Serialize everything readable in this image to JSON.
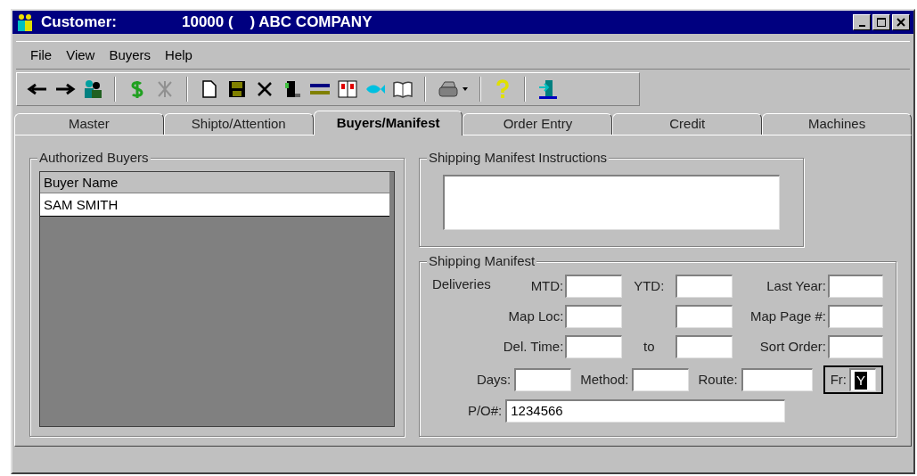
{
  "window": {
    "title_label": "Customer:",
    "title_value": "10000 (    ) ABC COMPANY"
  },
  "menu": [
    "File",
    "View",
    "Buyers",
    "Help"
  ],
  "tabs": [
    {
      "label": "Master",
      "selected": false
    },
    {
      "label": "Shipto/Attention",
      "selected": false
    },
    {
      "label": "Buyers/Manifest",
      "selected": true
    },
    {
      "label": "Order Entry",
      "selected": false
    },
    {
      "label": "Credit",
      "selected": false
    },
    {
      "label": "Machines",
      "selected": false
    }
  ],
  "authorized_buyers": {
    "title": "Authorized Buyers",
    "column": "Buyer Name",
    "rows": [
      {
        "name": "SAM SMITH",
        "selected": false
      }
    ]
  },
  "instructions": {
    "title": "Shipping Manifest Instructions"
  },
  "manifest": {
    "title": "Shipping Manifest",
    "grid": [
      [
        {
          "kind": "label",
          "text": "Deliveries"
        },
        {
          "kind": "label",
          "text": "MTD:"
        },
        {
          "kind": "field"
        },
        {
          "kind": "label",
          "text": "YTD:"
        },
        {
          "kind": "field"
        },
        {
          "kind": "label",
          "text": "Last Year:"
        },
        {
          "kind": "field"
        }
      ],
      [
        {
          "kind": "blank"
        },
        {
          "kind": "label",
          "text": "Map Loc:"
        },
        {
          "kind": "field"
        },
        {
          "kind": "blank"
        },
        {
          "kind": "field"
        },
        {
          "kind": "label",
          "text": "Map Page #:"
        },
        {
          "kind": "field"
        }
      ],
      [
        {
          "kind": "blank"
        },
        {
          "kind": "label",
          "text": "Del. Time:"
        },
        {
          "kind": "field"
        },
        {
          "kind": "label",
          "text": "to"
        },
        {
          "kind": "field"
        },
        {
          "kind": "label",
          "text": "Sort Order:"
        },
        {
          "kind": "field"
        }
      ]
    ],
    "row4": [
      {
        "label": "Days:",
        "focused": false
      },
      {
        "label": "Method:",
        "focused": false
      },
      {
        "label": "Route:",
        "focused": false
      },
      {
        "label": "Fr:",
        "value": "Y",
        "focused": true
      }
    ],
    "po": {
      "label": "P/O#:",
      "value": "1234566"
    }
  }
}
